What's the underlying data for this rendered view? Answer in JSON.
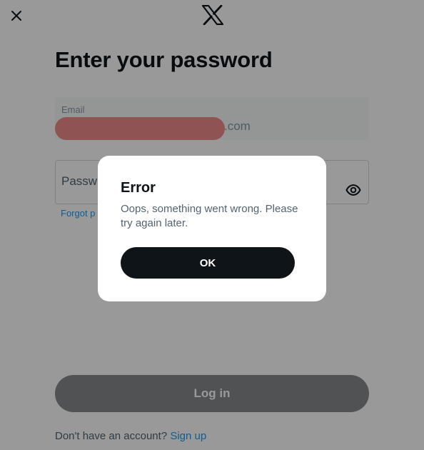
{
  "header": {
    "close_icon": "close-icon",
    "logo_icon": "x-logo-icon"
  },
  "form": {
    "title": "Enter your password",
    "email": {
      "label": "Email",
      "value_visible_suffix": ".com"
    },
    "password": {
      "placeholder": "Passw",
      "toggle_icon": "eye-icon"
    },
    "forgot_link": "Forgot p",
    "login_button": "Log in",
    "signup_prompt": "Don't have an account?",
    "signup_link": "Sign up"
  },
  "dialog": {
    "title": "Error",
    "message": "Oops, something went wrong. Please try again later.",
    "ok_button": "OK"
  },
  "colors": {
    "accent": "#1d9bf0",
    "text_primary": "#0f1419",
    "text_secondary": "#536471",
    "redaction": "#f08a8a",
    "button_disabled": "#87898c"
  }
}
